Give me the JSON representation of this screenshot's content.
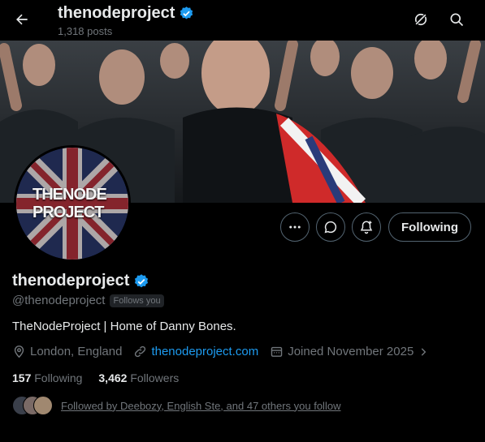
{
  "header": {
    "title": "thenodeproject",
    "posts_count": "1,318 posts"
  },
  "avatar": {
    "logo_line1": "THENODE",
    "logo_line2": "PROJECT"
  },
  "actions": {
    "following_label": "Following"
  },
  "profile": {
    "display_name": "thenodeproject",
    "handle": "@thenodeproject",
    "follows_you": "Follows you",
    "bio": "TheNodeProject | Home of Danny Bones.",
    "location": "London, England",
    "website": "thenodeproject.com",
    "joined": "Joined November 2025"
  },
  "stats": {
    "following_count": "157",
    "following_label": "Following",
    "followers_count": "3,462",
    "followers_label": "Followers"
  },
  "followed_by": "Followed by Deebozy, English Ste, and 47 others you follow",
  "colors": {
    "accent": "#1d9bf0",
    "muted": "#71767b",
    "background": "#000000",
    "text": "#e7e9ea"
  }
}
